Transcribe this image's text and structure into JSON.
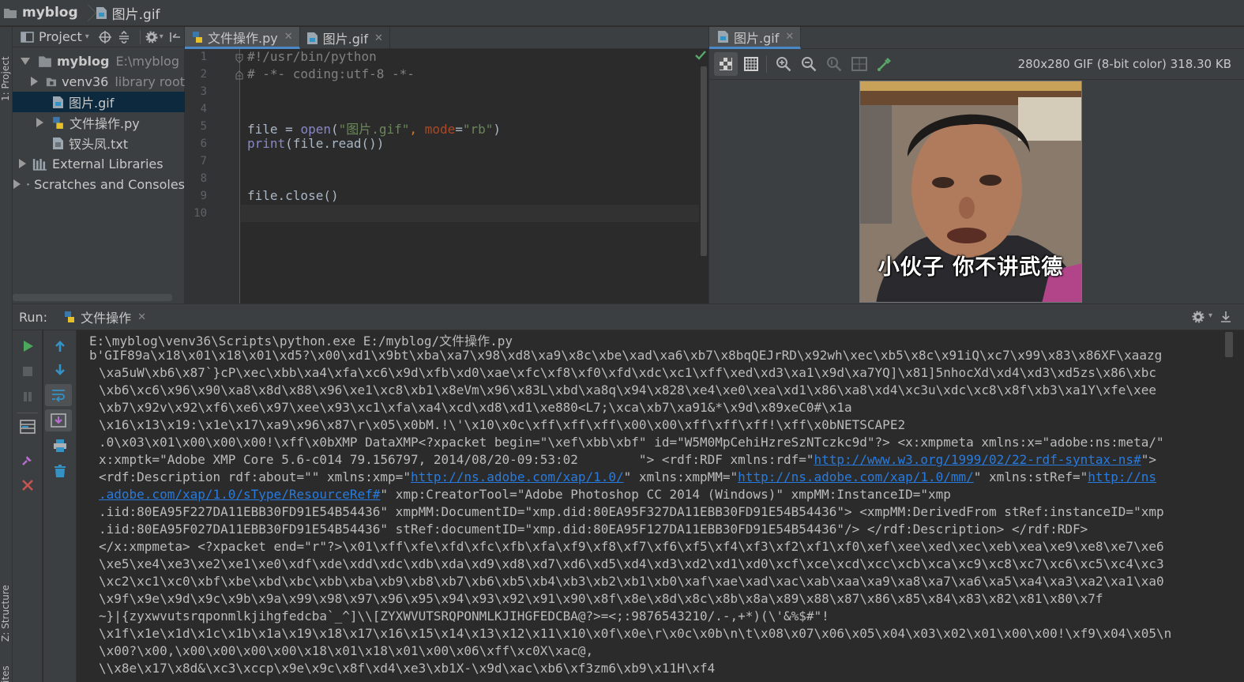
{
  "breadcrumb": {
    "project": "myblog",
    "file": "图片.gif"
  },
  "sidebar_labels": {
    "project": "1: Project",
    "structure": "Z: Structure",
    "favorites": "ites"
  },
  "project_panel": {
    "title": "Project",
    "items": [
      {
        "label": "myblog",
        "extra": "E:\\myblog"
      },
      {
        "label": "venv36",
        "extra": "library root"
      },
      {
        "label": "图片.gif",
        "extra": ""
      },
      {
        "label": "文件操作.py",
        "extra": ""
      },
      {
        "label": "钗头凤.txt",
        "extra": ""
      },
      {
        "label": "External Libraries",
        "extra": ""
      },
      {
        "label": "Scratches and Consoles",
        "extra": ""
      }
    ]
  },
  "editor": {
    "tabs": [
      {
        "label": "文件操作.py"
      },
      {
        "label": "图片.gif"
      }
    ],
    "line_numbers": [
      "1",
      "2",
      "3",
      "4",
      "5",
      "6",
      "7",
      "8",
      "9",
      "10"
    ],
    "code": {
      "l1": "#!/usr/bin/python",
      "l2": "# -*- coding:utf-8 -*-",
      "l5a": "file = ",
      "l5b": "open",
      "l5c": "(",
      "l5d": "\"图片.gif\"",
      "l5e": ", ",
      "l5f": "mode",
      "l5g": "=",
      "l5h": "\"rb\"",
      "l5i": ")",
      "l6a": "print",
      "l6b": "(file.read())",
      "l9": "file.close()"
    }
  },
  "image_viewer": {
    "tab": "图片.gif",
    "info": "280x280 GIF (8-bit color) 318.30 KB",
    "caption": "小伙子 你不讲武德"
  },
  "run": {
    "label": "Run:",
    "tab": "文件操作",
    "output": {
      "l1": "E:\\myblog\\venv36\\Scripts\\python.exe E:/myblog/文件操作.py",
      "l2": "b'GIF89a\\x18\\x01\\x18\\x01\\xd5?\\x00\\xd1\\x9bt\\xba\\xa7\\x98\\xd8\\xa9\\x8c\\xbe\\xad\\xa6\\xb7\\x8bqQEJrRD\\x92wh\\xec\\xb5\\x8c\\x91iQ\\xc7\\x99\\x83\\x86XF\\xaazg",
      "l3": "\\xa5uW\\xb6\\x87`}cP\\xec\\xbb\\xa4\\xfa\\xc6\\x9d\\xfb\\xd0\\xae\\xfc\\xf8\\xf0\\xfd\\xdc\\xc1\\xff\\xed\\xd3\\xa1\\x9d\\xa7YQ]\\x81]5nhocXd\\xd4\\xd3\\xd5zs\\x86\\xbc",
      "l4": "\\xb6\\xc6\\x96\\x90\\xa8\\x8d\\x88\\x96\\xe1\\xc8\\xb1\\x8eVm\\x96\\x83L\\xbd\\xa8q\\x94\\x828\\xe4\\xe0\\xea\\xd1\\x86\\xa8\\xd4\\xc3u\\xdc\\xc8\\x8f\\xb3\\xa1Y\\xfe\\xee",
      "l5": "\\xb7\\x92v\\x92\\xf6\\xe6\\x97\\xee\\x93\\xc1\\xfa\\xa4\\xcd\\xd8\\xd1\\xe880<L7;\\xca\\xb7\\xa91&*\\x9d\\x89xeC0#\\x1a",
      "l6": "\\x16\\x13\\x19:\\x1e\\x17\\xa9\\x96\\x87\\r\\x05\\x0bM.!\\'\\x10\\x0c\\xff\\xff\\xff\\x00\\x00\\xff\\xff\\xff!\\xff\\x0bNETSCAPE2",
      "l7": ".0\\x03\\x01\\x00\\x00\\x00!\\xff\\x0bXMP DataXMP<?xpacket begin=\"\\xef\\xbb\\xbf\" id=\"W5M0MpCehiHzreSzNTczkc9d\"?> <x:xmpmeta xmlns:x=\"adobe:ns:meta/\"",
      "l8a": "x:xmptk=\"Adobe XMP Core 5.6-c014 79.156797, 2014/08/20-09:53:02        \"> <rdf:RDF xmlns:rdf=\"",
      "l8link": "http://www.w3.org/1999/02/22-rdf-syntax-ns#",
      "l8b": "\">",
      "l9a": "<rdf:Description rdf:about=\"\" xmlns:xmp=\"",
      "l9link1": "http://ns.adobe.com/xap/1.0/",
      "l9b": "\" xmlns:xmpMM=\"",
      "l9link2": "http://ns.adobe.com/xap/1.0/mm/",
      "l9c": "\" xmlns:stRef=\"",
      "l9link3": "http://ns",
      "l10link": ".adobe.com/xap/1.0/sType/ResourceRef#",
      "l10b": "\" xmp:CreatorTool=\"Adobe Photoshop CC 2014 (Windows)\" xmpMM:InstanceID=\"xmp",
      "l11": ".iid:80EA95F227DA11EBB30FD91E54B54436\" xmpMM:DocumentID=\"xmp.did:80EA95F327DA11EBB30FD91E54B54436\"> <xmpMM:DerivedFrom stRef:instanceID=\"xmp",
      "l12": ".iid:80EA95F027DA11EBB30FD91E54B54436\" stRef:documentID=\"xmp.did:80EA95F127DA11EBB30FD91E54B54436\"/> </rdf:Description> </rdf:RDF>",
      "l13": "</x:xmpmeta> <?xpacket end=\"r\"?>\\x01\\xff\\xfe\\xfd\\xfc\\xfb\\xfa\\xf9\\xf8\\xf7\\xf6\\xf5\\xf4\\xf3\\xf2\\xf1\\xf0\\xef\\xee\\xed\\xec\\xeb\\xea\\xe9\\xe8\\xe7\\xe6",
      "l14": "\\xe5\\xe4\\xe3\\xe2\\xe1\\xe0\\xdf\\xde\\xdd\\xdc\\xdb\\xda\\xd9\\xd8\\xd7\\xd6\\xd5\\xd4\\xd3\\xd2\\xd1\\xd0\\xcf\\xce\\xcd\\xcc\\xcb\\xca\\xc9\\xc8\\xc7\\xc6\\xc5\\xc4\\xc3",
      "l15": "\\xc2\\xc1\\xc0\\xbf\\xbe\\xbd\\xbc\\xbb\\xba\\xb9\\xb8\\xb7\\xb6\\xb5\\xb4\\xb3\\xb2\\xb1\\xb0\\xaf\\xae\\xad\\xac\\xab\\xaa\\xa9\\xa8\\xa7\\xa6\\xa5\\xa4\\xa3\\xa2\\xa1\\xa0",
      "l16": "\\x9f\\x9e\\x9d\\x9c\\x9b\\x9a\\x99\\x98\\x97\\x96\\x95\\x94\\x93\\x92\\x91\\x90\\x8f\\x8e\\x8d\\x8c\\x8b\\x8a\\x89\\x88\\x87\\x86\\x85\\x84\\x83\\x82\\x81\\x80\\x7f",
      "l17": "~}|{zyxwvutsrqponmlkjihgfedcba`_^]\\\\[ZYXWVUTSRQPONMLKJIHGFEDCBA@?>=<;:9876543210/.-,+*)(\\'&%$#\"!",
      "l18": "\\x1f\\x1e\\x1d\\x1c\\x1b\\x1a\\x19\\x18\\x17\\x16\\x15\\x14\\x13\\x12\\x11\\x10\\x0f\\x0e\\r\\x0c\\x0b\\n\\t\\x08\\x07\\x06\\x05\\x04\\x03\\x02\\x01\\x00\\x00!\\xf9\\x04\\x05\\n",
      "l19": "\\x00?\\x00,\\x00\\x00\\x00\\x00\\x18\\x01\\x18\\x01\\x00\\x06\\xff\\xc0X\\xac@,",
      "l20": "\\\\x8e\\x17\\x8d&\\xc3\\xccp\\x9e\\x9c\\x8f\\xd4\\xe3\\xb1X-\\x9d\\xac\\xb6\\xf3zm6\\xb9\\x11H\\xf4"
    }
  },
  "colors": {
    "accent": "#4a88c7",
    "link": "#287bde",
    "run_green": "#4ca85c",
    "stop_red": "#c75450",
    "check_green": "#59a869"
  }
}
